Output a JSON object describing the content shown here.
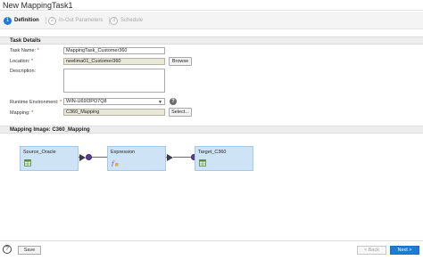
{
  "window": {
    "title": "New MappingTask1"
  },
  "steps": [
    {
      "num": "1",
      "label": "Definition"
    },
    {
      "num": "2",
      "label": "In-Out Parameters"
    },
    {
      "num": "3",
      "label": "Schedule"
    }
  ],
  "task_details": {
    "header": "Task Details",
    "task_name": {
      "label": "Task Name:",
      "required": "*",
      "value": "MappingTask_Customer360"
    },
    "location": {
      "label": "Location:",
      "required": "*",
      "value": "neelima01_Customer360",
      "button": "Browse"
    },
    "description": {
      "label": "Description:",
      "value": ""
    },
    "runtime_environment": {
      "label": "Runtime Environment:",
      "required": "*",
      "value": "WIN-U69I3PO7Q8"
    },
    "mapping": {
      "label": "Mapping:",
      "required": "*",
      "value": "C360_Mapping",
      "button": "Select..."
    }
  },
  "mapping_image": {
    "header_label": "Mapping Image:",
    "header_value": "C360_Mapping",
    "nodes": [
      {
        "name": "Source_Oracle",
        "icon": "source-table-icon"
      },
      {
        "name": "Expression",
        "icon": "expression-icon"
      },
      {
        "name": "Target_C360",
        "icon": "target-table-icon"
      }
    ]
  },
  "footer": {
    "save": "Save",
    "back": "< Back",
    "next": "Next >",
    "help": "?"
  },
  "colors": {
    "accent": "#1f7ad6",
    "node_fill": "#cfe3f7",
    "port": "#5a3e8c"
  }
}
